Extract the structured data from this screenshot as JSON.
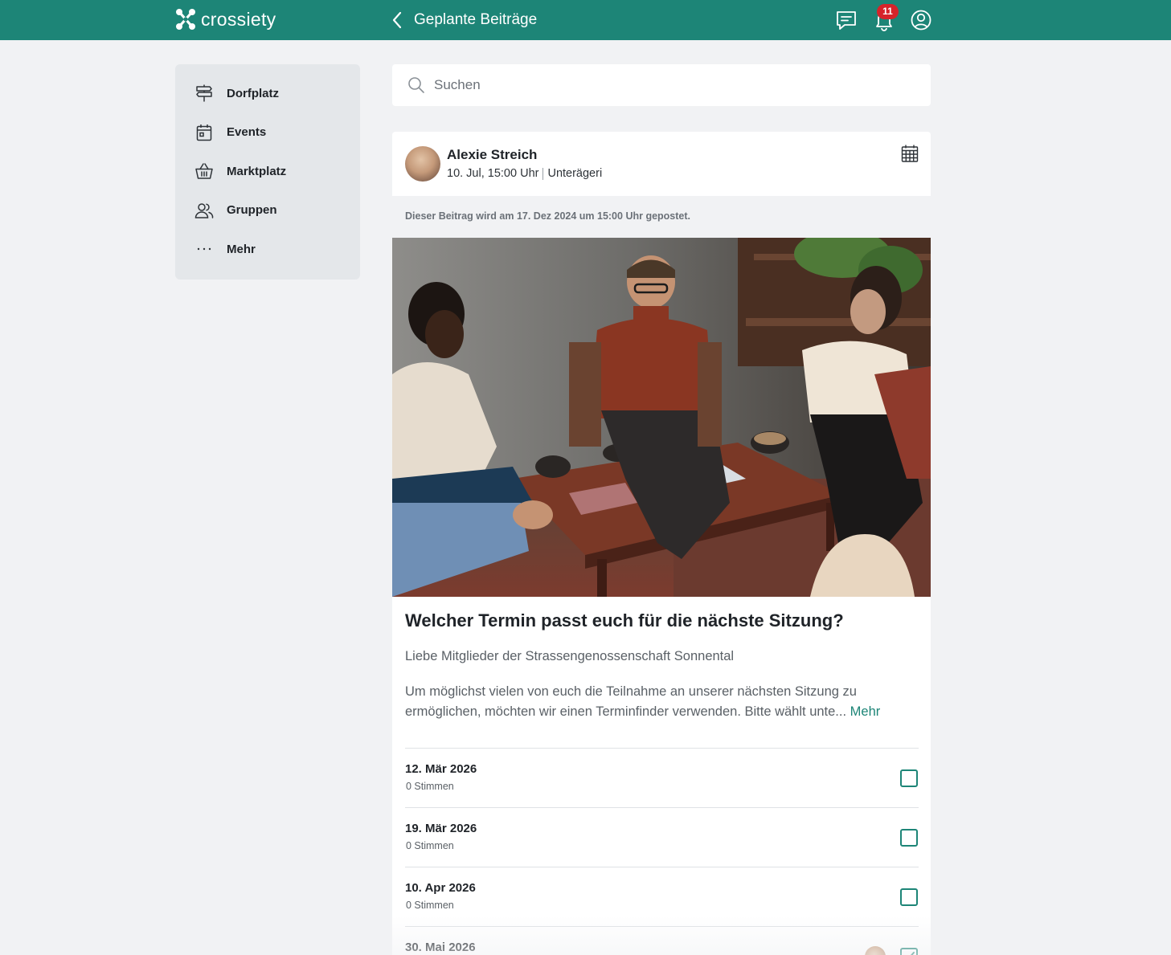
{
  "app": {
    "brand": "crossiety",
    "header_title": "Geplante Beiträge",
    "notification_count": "11",
    "accent_color": "#1d8577"
  },
  "header_icons": [
    "back-icon",
    "chat-icon",
    "bell-icon",
    "user-icon"
  ],
  "sidebar": {
    "items": [
      {
        "label": "Dorfplatz",
        "icon": "signpost-icon"
      },
      {
        "label": "Events",
        "icon": "calendar-icon"
      },
      {
        "label": "Marktplatz",
        "icon": "basket-icon"
      },
      {
        "label": "Gruppen",
        "icon": "users-icon"
      },
      {
        "label": "Mehr",
        "icon": "more-icon"
      }
    ]
  },
  "search": {
    "placeholder": "Suchen"
  },
  "post": {
    "author": "Alexie Streich",
    "date": "10. Jul, 15:00 Uhr",
    "location": "Unterägeri",
    "schedule_note": "Dieser Beitrag wird am 17. Dez 2024 um 15:00 Uhr gepostet.",
    "title": "Welcher Termin passt euch für die nächste Sitzung?",
    "greeting": "Liebe Mitglieder der Strassengenossenschaft Sonnental",
    "text": "Um möglichst vielen von euch die Teilnahme an unserer nächsten Sitzung zu ermöglichen, möchten wir einen Terminfinder verwenden. Bitte wählt unte...",
    "more": "Mehr"
  },
  "poll": {
    "options": [
      {
        "date": "12. Mär 2026",
        "votes": "0 Stimmen",
        "checked": false
      },
      {
        "date": "19. Mär 2026",
        "votes": "0 Stimmen",
        "checked": false
      },
      {
        "date": "10. Apr 2026",
        "votes": "0 Stimmen",
        "checked": false
      },
      {
        "date": "30. Mai 2026",
        "votes": "",
        "checked": true
      }
    ]
  }
}
